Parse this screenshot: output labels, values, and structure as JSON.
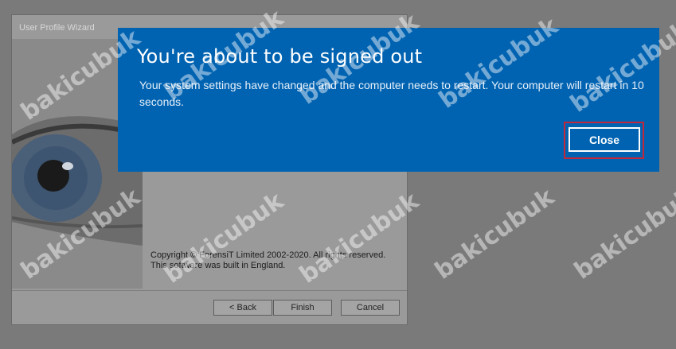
{
  "wizard": {
    "title": "User Profile Wizard",
    "copyright_line1": "Copyright © ForensiT Limited 2002-2020. All rights reserved.",
    "copyright_line2": "This software was built in England.",
    "buttons": {
      "back": "< Back",
      "finish": "Finish",
      "cancel": "Cancel"
    }
  },
  "dialog": {
    "title": "You're about to be signed out",
    "message": "Your system settings have changed and the computer needs to restart. Your computer will restart in 10 seconds.",
    "close_label": "Close",
    "background_color": "#0063b1",
    "highlight_color": "#c0283e"
  },
  "watermark": {
    "text": "bakicubuk"
  }
}
